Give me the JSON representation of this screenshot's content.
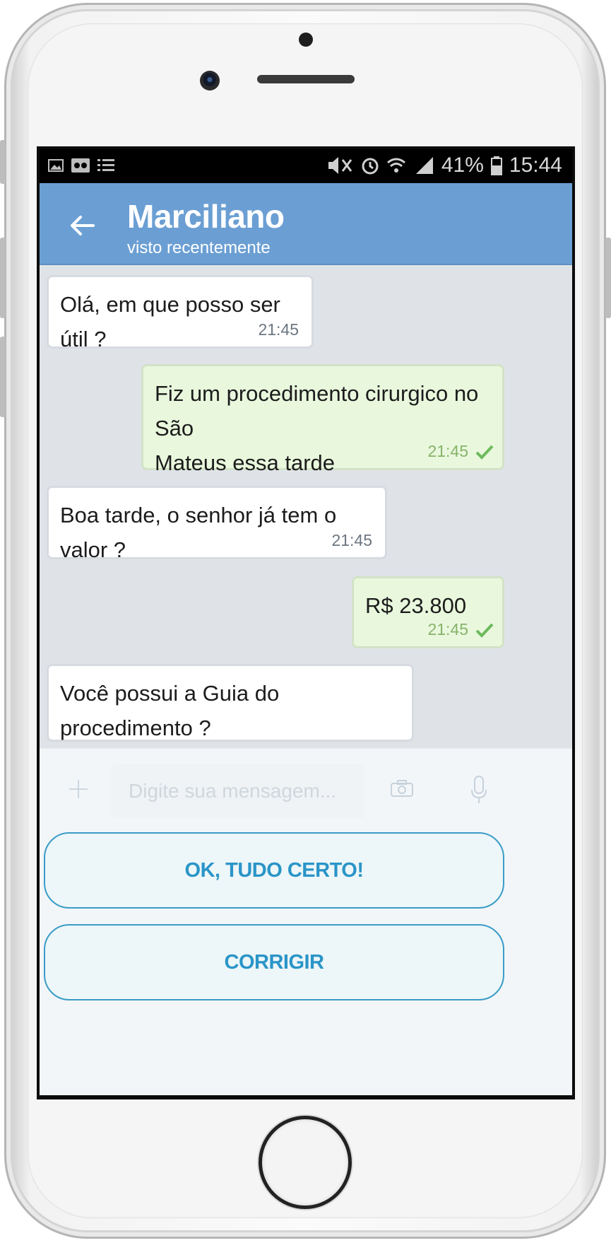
{
  "status_bar": {
    "battery": "41%",
    "time": "15:44"
  },
  "header": {
    "contact_name": "Marciliano",
    "contact_status": "visto recentemente"
  },
  "messages": [
    {
      "direction": "incoming",
      "text": "Olá, em que posso ser útil ?",
      "time": "21:45"
    },
    {
      "direction": "outgoing",
      "text_line1": "Fiz um procedimento cirurgico no São",
      "text_line2": "Mateus essa tarde",
      "time": "21:45",
      "status": "sent"
    },
    {
      "direction": "incoming",
      "text": "Boa tarde, o senhor já tem o valor ?",
      "time": "21:45"
    },
    {
      "direction": "outgoing",
      "text": "R$ 23.800",
      "time": "21:45",
      "status": "sent"
    },
    {
      "direction": "incoming",
      "text": "Você possui a Guia do procedimento ?"
    }
  ],
  "composer": {
    "placeholder": "Digite sua mensagem..."
  },
  "actions": {
    "confirm_label": "OK, TUDO CERTO!",
    "correct_label": "CORRIGIR"
  },
  "colors": {
    "header_bg": "#6b9fd3",
    "chat_bg": "#dfe3e8",
    "outgoing_bubble": "#e9f8dd",
    "incoming_bubble": "#ffffff",
    "action_accent": "#2a95c8"
  },
  "icons": [
    "image-icon",
    "voicemail-icon",
    "list-icon",
    "mute-icon",
    "alarm-icon",
    "wifi-icon",
    "signal-icon",
    "battery-icon",
    "back-arrow-icon",
    "plus-icon",
    "camera-icon",
    "microphone-icon",
    "checkmark-icon"
  ]
}
